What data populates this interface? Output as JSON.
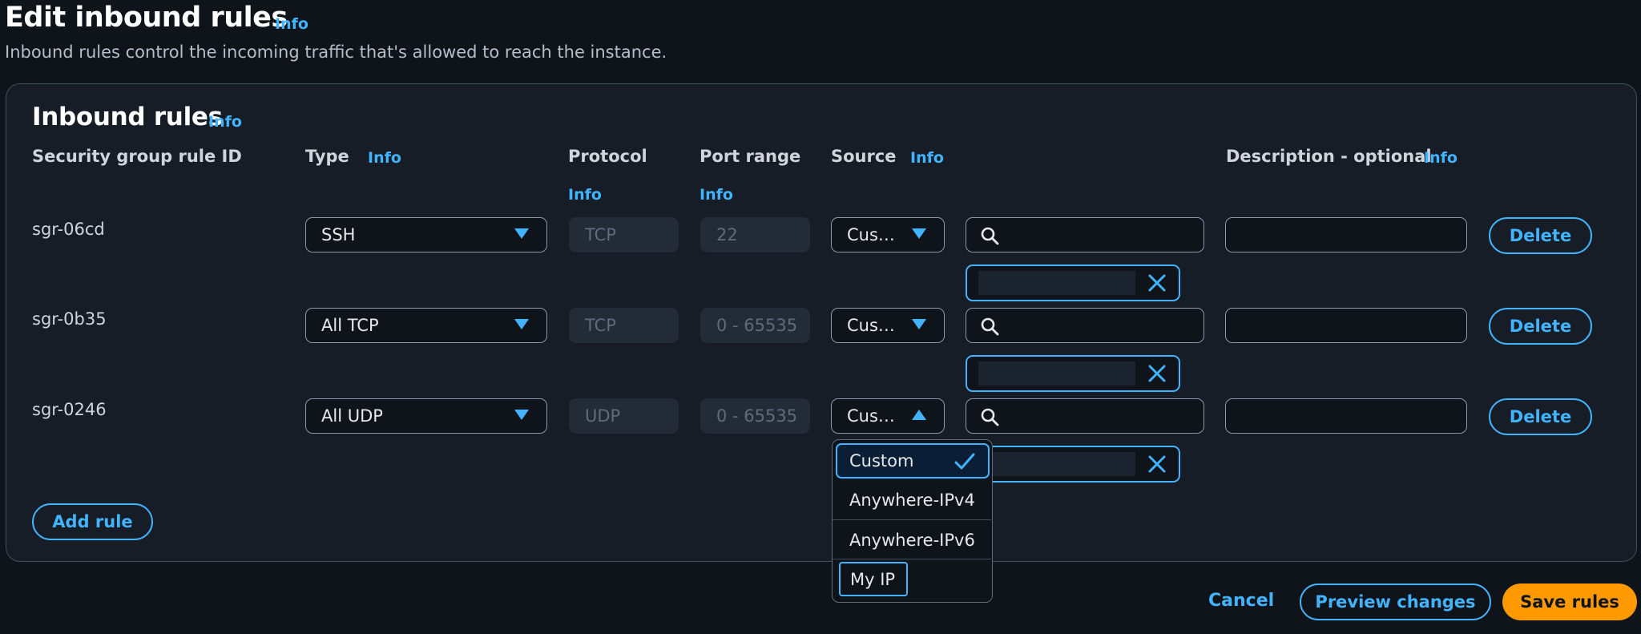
{
  "header": {
    "title": "Edit inbound rules",
    "info": "Info",
    "subtitle": "Inbound rules control the incoming traffic that's allowed to reach the instance."
  },
  "panel": {
    "title": "Inbound rules",
    "info": "Info"
  },
  "columns": {
    "rule_id": "Security group rule ID",
    "type": "Type",
    "type_info": "Info",
    "protocol": "Protocol",
    "protocol_info": "Info",
    "port_range": "Port range",
    "port_range_info": "Info",
    "source": "Source",
    "source_info": "Info",
    "description": "Description - optional",
    "description_info": "Info"
  },
  "rules": [
    {
      "id": "sgr-06cd",
      "type": "SSH",
      "protocol": "TCP",
      "port_range": "22",
      "source": "Cus…",
      "delete": "Delete"
    },
    {
      "id": "sgr-0b35",
      "type": "All TCP",
      "protocol": "TCP",
      "port_range": "0 - 65535",
      "source": "Cus…",
      "delete": "Delete"
    },
    {
      "id": "sgr-0246",
      "type": "All UDP",
      "protocol": "UDP",
      "port_range": "0 - 65535",
      "source": "Cus…",
      "delete": "Delete"
    }
  ],
  "source_dropdown": {
    "options": [
      "Custom",
      "Anywhere-IPv4",
      "Anywhere-IPv6",
      "My IP"
    ],
    "selected": "Custom",
    "focused": "My IP"
  },
  "actions": {
    "add_rule": "Add rule",
    "cancel": "Cancel",
    "preview": "Preview changes",
    "save": "Save rules"
  },
  "colors": {
    "accent": "#42b4ff",
    "primary_button": "#ff9900",
    "background": "#0f141a",
    "panel": "#161d26"
  },
  "icons": {
    "caret_down": "caret-down-icon",
    "caret_up": "caret-up-icon",
    "search": "search-icon",
    "close": "close-icon",
    "check": "check-icon"
  }
}
